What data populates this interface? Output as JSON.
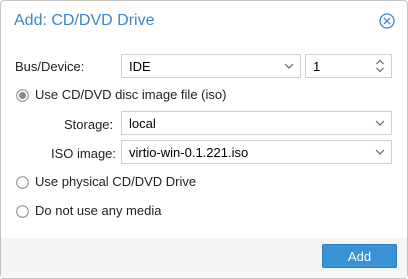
{
  "dialog": {
    "title": "Add: CD/DVD Drive",
    "add_label": "Add"
  },
  "bus_device": {
    "label": "Bus/Device:",
    "bus_value": "IDE",
    "device_value": "1"
  },
  "options": {
    "iso_label": "Use CD/DVD disc image file (iso)",
    "physical_label": "Use physical CD/DVD Drive",
    "no_media_label": "Do not use any media",
    "selected": "iso"
  },
  "storage": {
    "label": "Storage:",
    "value": "local"
  },
  "iso_image": {
    "label": "ISO image:",
    "value": "virtio-win-0.1.221.iso"
  },
  "colors": {
    "accent": "#3a87c8",
    "button": "#3892d4"
  },
  "icons": {
    "close": "close-circle-icon",
    "dropdown": "chevron-down-icon",
    "spinner": "spinner-updown-icon"
  }
}
